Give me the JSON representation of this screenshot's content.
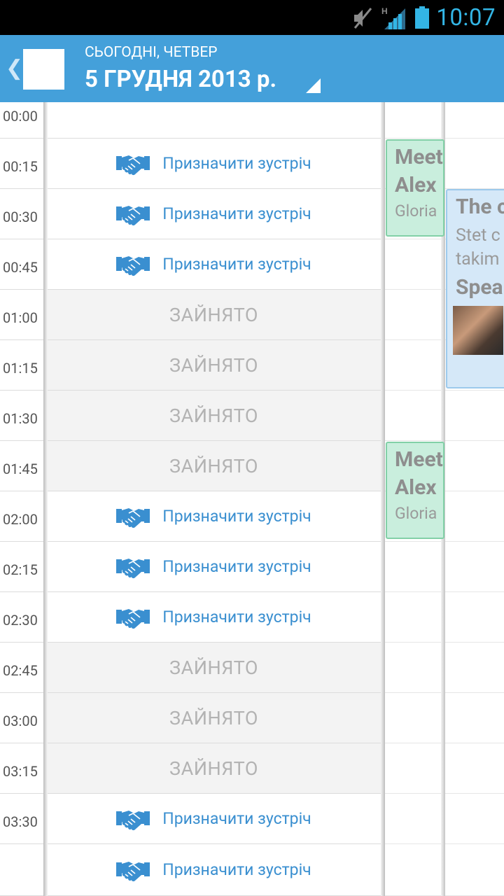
{
  "status_bar": {
    "time": "10:07",
    "signal_type": "H"
  },
  "header": {
    "subtitle": "СЬОГОДНІ, ЧЕТВЕР",
    "title": "5 ГРУДНЯ 2013 р."
  },
  "times": [
    "00:00",
    "00:15",
    "00:30",
    "00:45",
    "01:00",
    "01:15",
    "01:30",
    "01:45",
    "02:00",
    "02:15",
    "02:30",
    "02:45",
    "03:00",
    "03:15",
    "03:30",
    ""
  ],
  "slots": [
    {
      "state": "empty",
      "label": ""
    },
    {
      "state": "book",
      "label": "Призначити зустріч"
    },
    {
      "state": "book",
      "label": "Призначити зустріч"
    },
    {
      "state": "book",
      "label": "Призначити зустріч"
    },
    {
      "state": "busy",
      "label": "ЗАЙНЯТО"
    },
    {
      "state": "busy",
      "label": "ЗАЙНЯТО"
    },
    {
      "state": "busy",
      "label": "ЗАЙНЯТО"
    },
    {
      "state": "busy",
      "label": "ЗАЙНЯТО"
    },
    {
      "state": "book",
      "label": "Призначити зустріч"
    },
    {
      "state": "book",
      "label": "Призначити зустріч"
    },
    {
      "state": "book",
      "label": "Призначити зустріч"
    },
    {
      "state": "busy",
      "label": "ЗАЙНЯТО"
    },
    {
      "state": "busy",
      "label": "ЗАЙНЯТО"
    },
    {
      "state": "busy",
      "label": "ЗАЙНЯТО"
    },
    {
      "state": "book",
      "label": "Призначити зустріч"
    },
    {
      "state": "book",
      "label": "Призначити зустріч"
    }
  ],
  "events": {
    "meeting1": {
      "line1": "Meeting",
      "line2": "Alex",
      "line3": "Gloria"
    },
    "meeting2": {
      "line1": "Meeting",
      "line2": "Alex",
      "line3": "Gloria"
    },
    "talk": {
      "title": "The c",
      "desc1": "Stet c",
      "desc2": "takim",
      "speaker": "Speaker"
    }
  },
  "colors": {
    "accent": "#44a0da",
    "link": "#3a8fd0",
    "busy_bg": "#f3f3f3",
    "event_green": "#c9eedd",
    "event_blue": "#d5e8f8"
  }
}
